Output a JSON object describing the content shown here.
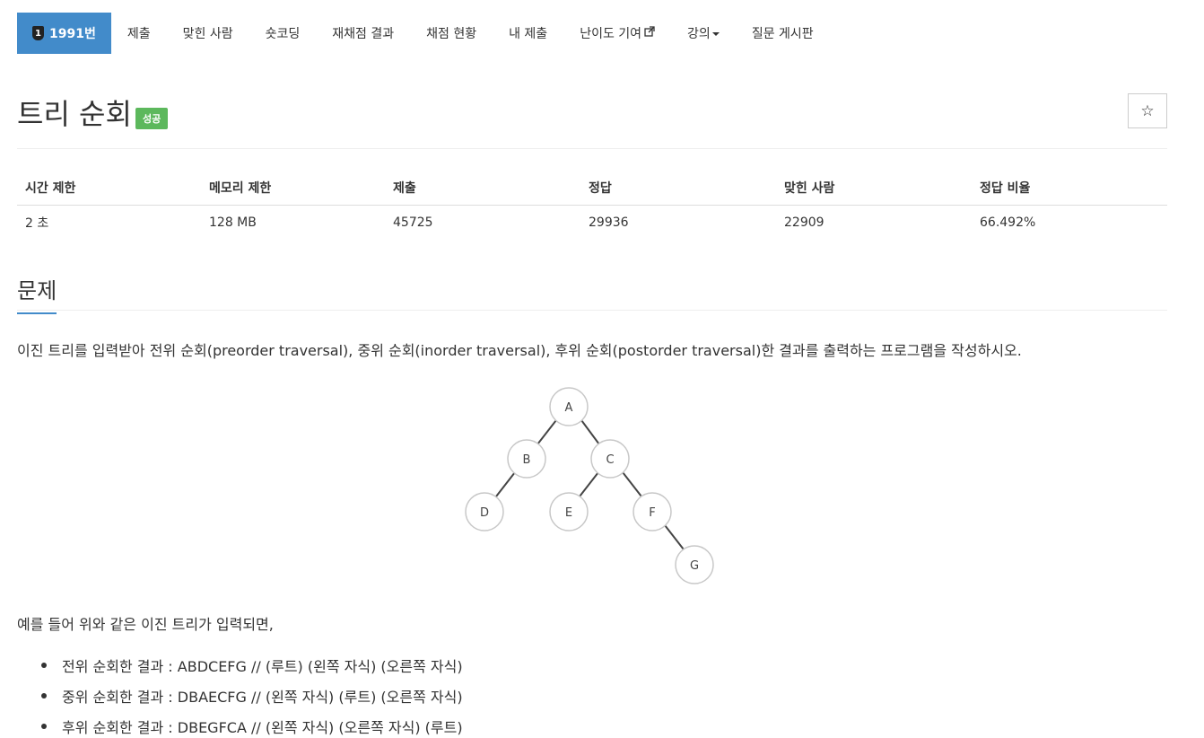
{
  "nav": {
    "tabs": [
      {
        "label": "1991번",
        "icon": "problem-number-icon",
        "active": true
      },
      {
        "label": "제출"
      },
      {
        "label": "맞힌 사람"
      },
      {
        "label": "숏코딩"
      },
      {
        "label": "재채점 결과"
      },
      {
        "label": "채점 현황"
      },
      {
        "label": "내 제출"
      },
      {
        "label": "난이도 기여",
        "icon": "external-link-icon"
      },
      {
        "label": "강의",
        "icon": "caret-down-icon"
      },
      {
        "label": "질문 게시판"
      }
    ],
    "active_color": "#428bca",
    "badge_digit": "1"
  },
  "problem": {
    "title": "트리 순회",
    "status_badge": "성공",
    "status_color": "#5cb85c",
    "star_icon": "star-icon",
    "star_glyph": "☆"
  },
  "info_table": {
    "headers": [
      "시간 제한",
      "메모리 제한",
      "제출",
      "정답",
      "맞힌 사람",
      "정답 비율"
    ],
    "values": [
      "2 초",
      "128 MB",
      "45725",
      "29936",
      "22909",
      "66.492%"
    ]
  },
  "section": {
    "title": "문제",
    "description": "이진 트리를 입력받아 전위 순회(preorder traversal), 중위 순회(inorder traversal), 후위 순회(postorder traversal)한 결과를 출력하는 프로그램을 작성하시오."
  },
  "tree_figure": {
    "nodes": [
      "A",
      "B",
      "C",
      "D",
      "E",
      "F",
      "G"
    ]
  },
  "example": {
    "intro": "예를 들어 위와 같은 이진 트리가 입력되면,",
    "results": [
      "전위 순회한 결과 : ABDCEFG // (루트) (왼쪽 자식) (오른쪽 자식)",
      "중위 순회한 결과 : DBAECFG // (왼쪽 자식) (루트) (오른쪽 자식)",
      "후위 순회한 결과 : DBEGFCA // (왼쪽 자식) (오른쪽 자식) (루트)"
    ]
  }
}
